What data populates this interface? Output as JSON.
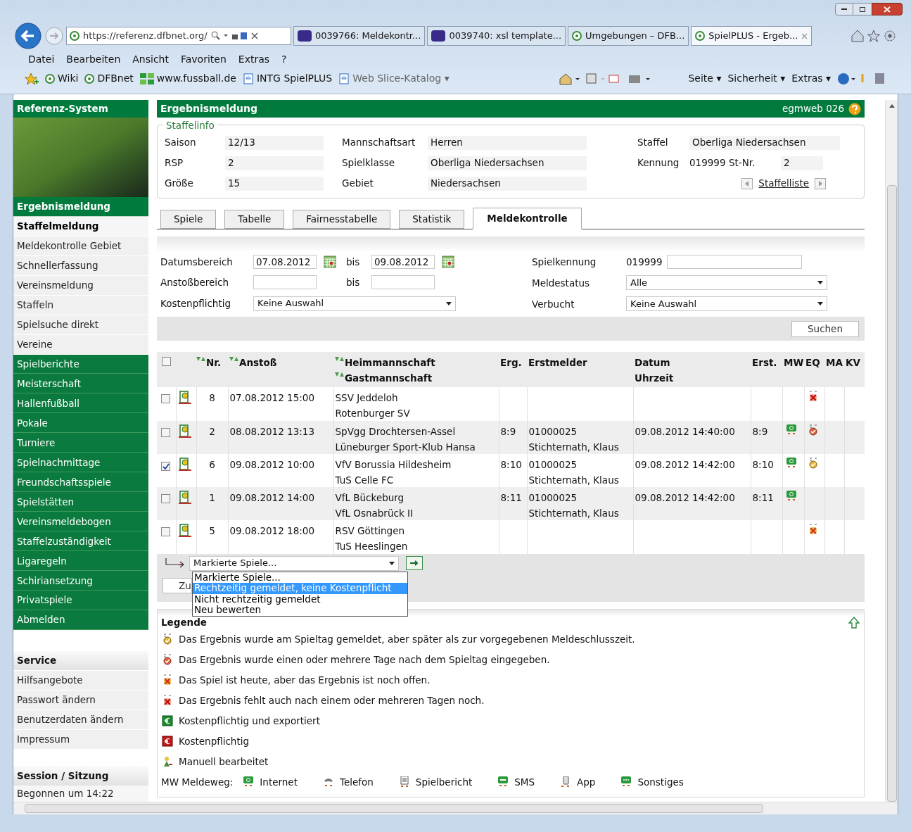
{
  "browser": {
    "url": "https://referenz.dfbnet.org/",
    "tabs": [
      {
        "label": "0039766: Meldekontr...",
        "kind": "mantis",
        "selected": false
      },
      {
        "label": "0039740: xsl template...",
        "kind": "mantis",
        "selected": false
      },
      {
        "label": "Umgebungen – DFB...",
        "kind": "site",
        "selected": false
      },
      {
        "label": "SpielPLUS - Ergeb...",
        "kind": "site",
        "selected": true
      }
    ],
    "menu": [
      "Datei",
      "Bearbeiten",
      "Ansicht",
      "Favoriten",
      "Extras",
      "?"
    ],
    "favorites": [
      {
        "label": "Wiki",
        "kind": "site"
      },
      {
        "label": "DFBnet",
        "kind": "site"
      },
      {
        "label": "www.fussball.de",
        "kind": "grid"
      },
      {
        "label": "INTG SpielPLUS",
        "kind": "page"
      },
      {
        "label": "Web Slice-Katalog ▾",
        "kind": "page"
      }
    ],
    "commands": [
      "Seite ▾",
      "Sicherheit ▾",
      "Extras ▾"
    ]
  },
  "sidebar": {
    "title": "Referenz-System",
    "items": [
      {
        "label": "Ergebnismeldung",
        "kind": "group",
        "selected": false
      },
      {
        "label": "Staffelmeldung",
        "kind": "sub",
        "selected": true
      },
      {
        "label": "Meldekontrolle Gebiet",
        "kind": "sub",
        "selected": false
      },
      {
        "label": "Schnellerfassung",
        "kind": "sub",
        "selected": false
      },
      {
        "label": "Vereinsmeldung",
        "kind": "sub",
        "selected": false
      },
      {
        "label": "Staffeln",
        "kind": "sub",
        "selected": false
      },
      {
        "label": "Spielsuche direkt",
        "kind": "sub",
        "selected": false
      },
      {
        "label": "Vereine",
        "kind": "sub",
        "selected": false
      },
      {
        "label": "Spielberichte",
        "kind": "link",
        "selected": false
      },
      {
        "label": "Meisterschaft",
        "kind": "link",
        "selected": false
      },
      {
        "label": "Hallenfußball",
        "kind": "link",
        "selected": false
      },
      {
        "label": "Pokale",
        "kind": "link",
        "selected": false
      },
      {
        "label": "Turniere",
        "kind": "link",
        "selected": false
      },
      {
        "label": "Spielnachmittage",
        "kind": "link",
        "selected": false
      },
      {
        "label": "Freundschaftsspiele",
        "kind": "link",
        "selected": false
      },
      {
        "label": "Spielstätten",
        "kind": "link",
        "selected": false
      },
      {
        "label": "Vereinsmeldebogen",
        "kind": "link",
        "selected": false
      },
      {
        "label": "Staffelzuständigkeit",
        "kind": "link",
        "selected": false
      },
      {
        "label": "Ligaregeln",
        "kind": "link",
        "selected": false
      },
      {
        "label": "Schiriansetzung",
        "kind": "link",
        "selected": false
      },
      {
        "label": "Privatspiele",
        "kind": "link",
        "selected": false
      },
      {
        "label": "Abmelden",
        "kind": "link",
        "selected": false
      }
    ],
    "service": {
      "title": "Service",
      "items": [
        "Hilfsangebote",
        "Passwort ändern",
        "Benutzerdaten ändern",
        "Impressum"
      ]
    },
    "session": {
      "title": "Session / Sitzung",
      "text": "Begonnen um 14:22"
    }
  },
  "header": {
    "title": "Ergebnismeldung",
    "code": "egmweb 026"
  },
  "staffelinfo": {
    "legend": "Staffelinfo",
    "columns": [
      [
        {
          "label": "Saison",
          "value": "12/13"
        },
        {
          "label": "RSP",
          "value": "2"
        },
        {
          "label": "Größe",
          "value": "15"
        }
      ],
      [
        {
          "label": "Mannschaftsart",
          "value": "Herren"
        },
        {
          "label": "Spielklasse",
          "value": "Oberliga Niedersachsen"
        },
        {
          "label": "Gebiet",
          "value": "Niedersachsen"
        }
      ]
    ],
    "staffel": {
      "label": "Staffel",
      "value": "Oberliga Niedersachsen"
    },
    "kennung": {
      "label": "Kennung",
      "value": "019999"
    },
    "st_nr": {
      "label": "St-Nr.",
      "value": "2"
    },
    "list_link": "Staffelliste"
  },
  "tabs": [
    {
      "label": "Spiele",
      "selected": false
    },
    {
      "label": "Tabelle",
      "selected": false
    },
    {
      "label": "Fairnesstabelle",
      "selected": false
    },
    {
      "label": "Statistik",
      "selected": false
    },
    {
      "label": "Meldekontrolle",
      "selected": true
    }
  ],
  "filter": {
    "date": {
      "label": "Datumsbereich",
      "from": "07.08.2012",
      "to_label": "bis",
      "to": "09.08.2012"
    },
    "kickoff": {
      "label": "Anstoßbereich",
      "to_label": "bis"
    },
    "cost": {
      "label": "Kostenpflichtig",
      "value": "Keine Auswahl"
    },
    "game_id": {
      "label": "Spielkennung",
      "prefix": "019999"
    },
    "status": {
      "label": "Meldestatus",
      "value": "Alle"
    },
    "booked": {
      "label": "Verbucht",
      "value": "Keine Auswahl"
    },
    "search_button": "Suchen"
  },
  "table": {
    "columns": {
      "nr": "Nr.",
      "kickoff": "Anstoß",
      "home": "Heimmannschaft",
      "guest": "Gastmannschaft",
      "result": "Erg.",
      "reporter": "Erstmelder",
      "date": "Datum",
      "time": "Uhrzeit",
      "first": "Erst.",
      "mw": "MW",
      "eq": "EQ",
      "ma": "MA",
      "kv": "KV"
    },
    "all_checked": false,
    "rows": [
      {
        "checked": false,
        "nr": "8",
        "kickoff": "07.08.2012 15:00",
        "home": "SSV Jeddeloh",
        "guest": "Rotenburger SV",
        "eq": {
          "kind": "missing"
        }
      },
      {
        "checked": false,
        "nr": "2",
        "kickoff": "08.08.2012 13:13",
        "home": "SpVgg Drochtersen-Assel",
        "guest": "Lüneburger Sport-Klub Hansa",
        "result": "8:9",
        "reporter_id": "01000025",
        "reporter": "Stichternath, Klaus",
        "date": "09.08.2012 14:40:00",
        "first": "8:9",
        "mw": {
          "kind": "internet"
        },
        "eq": {
          "kind": "days-late"
        }
      },
      {
        "checked": true,
        "nr": "6",
        "kickoff": "09.08.2012 10:00",
        "home": "VfV Borussia Hildesheim",
        "guest": "TuS Celle FC",
        "result": "8:10",
        "reporter_id": "01000025",
        "reporter": "Stichternath, Klaus",
        "date": "09.08.2012 14:42:00",
        "first": "8:10",
        "mw": {
          "kind": "internet"
        },
        "eq": {
          "kind": "late"
        }
      },
      {
        "checked": false,
        "nr": "1",
        "kickoff": "09.08.2012 14:00",
        "home": "VfL Bückeburg",
        "guest": "VfL Osnabrück II",
        "result": "8:11",
        "reporter_id": "01000025",
        "reporter": "Stichternath, Klaus",
        "date": "09.08.2012 14:42:00",
        "first": "8:11",
        "mw": {
          "kind": "internet"
        }
      },
      {
        "checked": false,
        "nr": "5",
        "kickoff": "09.08.2012 18:00",
        "home": "RSV Göttingen",
        "guest": "TuS Heeslingen",
        "eq": {
          "kind": "open"
        }
      }
    ]
  },
  "actions": {
    "select": "Markierte Spiele...",
    "button": "Zu",
    "options": [
      {
        "label": "Markierte Spiele...",
        "selected": false
      },
      {
        "label": "Rechtzeitig gemeldet, keine Kostenpflicht",
        "selected": true
      },
      {
        "label": "Nicht rechtzeitig gemeldet",
        "selected": false
      },
      {
        "label": "Neu bewerten",
        "selected": false
      }
    ]
  },
  "legend": {
    "title": "Legende",
    "items": [
      {
        "kind": "late",
        "text": "Das Ergebnis wurde am Spieltag gemeldet, aber später als zur vorgegebenen Meldeschlusszeit."
      },
      {
        "kind": "days-late",
        "text": "Das Ergebnis wurde einen oder mehrere Tage nach dem Spieltag eingegeben."
      },
      {
        "kind": "open",
        "text": "Das Spiel ist heute, aber das Ergebnis ist noch offen."
      },
      {
        "kind": "missing",
        "text": "Das Ergebnis fehlt auch nach einem oder mehreren Tagen noch."
      },
      {
        "kind": "paid-exported",
        "text": "Kostenpflichtig und exportiert"
      },
      {
        "kind": "paid",
        "text": "Kostenpflichtig"
      },
      {
        "kind": "manual",
        "text": "Manuell bearbeitet"
      }
    ],
    "channels_label": "MW Meldeweg:",
    "channels": [
      {
        "kind": "internet",
        "label": "Internet"
      },
      {
        "kind": "phone",
        "label": "Telefon"
      },
      {
        "kind": "report",
        "label": "Spielbericht"
      },
      {
        "kind": "sms",
        "label": "SMS"
      },
      {
        "kind": "app",
        "label": "App"
      },
      {
        "kind": "other",
        "label": "Sonstiges"
      }
    ]
  }
}
